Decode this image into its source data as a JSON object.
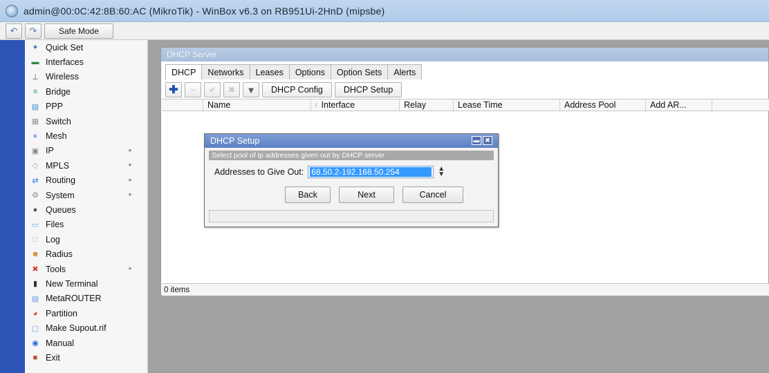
{
  "window": {
    "title": "admin@00:0C:42:8B:60:AC (MikroTik) - WinBox v6.3 on RB951Ui-2HnD (mipsbe)"
  },
  "toolbar": {
    "undo_icon": "undo-icon",
    "redo_icon": "redo-icon",
    "safe_mode": "Safe Mode"
  },
  "menu": [
    {
      "label": "Quick Set",
      "icon": "quick-set-icon",
      "arrow": false,
      "color": "#3a6fb8"
    },
    {
      "label": "Interfaces",
      "icon": "interfaces-icon",
      "arrow": false,
      "color": "#2b8a3e"
    },
    {
      "label": "Wireless",
      "icon": "wireless-icon",
      "arrow": false,
      "color": "#555555"
    },
    {
      "label": "Bridge",
      "icon": "bridge-icon",
      "arrow": false,
      "color": "#2c8f8f"
    },
    {
      "label": "PPP",
      "icon": "ppp-icon",
      "arrow": false,
      "color": "#3a8fd8"
    },
    {
      "label": "Switch",
      "icon": "switch-icon",
      "arrow": false,
      "color": "#9a9a9a"
    },
    {
      "label": "Mesh",
      "icon": "mesh-icon",
      "arrow": false,
      "color": "#5a8fd8"
    },
    {
      "label": "IP",
      "icon": "ip-icon",
      "arrow": true,
      "color": "#8a8a8a"
    },
    {
      "label": "MPLS",
      "icon": "mpls-icon",
      "arrow": true,
      "color": "#9aa4c8"
    },
    {
      "label": "Routing",
      "icon": "routing-icon",
      "arrow": true,
      "color": "#3a7ad8"
    },
    {
      "label": "System",
      "icon": "system-icon",
      "arrow": true,
      "color": "#8a8a8a"
    },
    {
      "label": "Queues",
      "icon": "queues-icon",
      "arrow": false,
      "color": "#555555"
    },
    {
      "label": "Files",
      "icon": "files-icon",
      "arrow": false,
      "color": "#7aa6d8"
    },
    {
      "label": "Log",
      "icon": "log-icon",
      "arrow": false,
      "color": "#a8a8a8"
    },
    {
      "label": "Radius",
      "icon": "radius-icon",
      "arrow": false,
      "color": "#d88a2a"
    },
    {
      "label": "Tools",
      "icon": "tools-icon",
      "arrow": true,
      "color": "#d83a3a"
    },
    {
      "label": "New Terminal",
      "icon": "terminal-icon",
      "arrow": false,
      "color": "#333333"
    },
    {
      "label": "MetaROUTER",
      "icon": "metarouter-icon",
      "arrow": false,
      "color": "#6a9ad8"
    },
    {
      "label": "Partition",
      "icon": "partition-icon",
      "arrow": false,
      "color": "#d8402a"
    },
    {
      "label": "Make Supout.rif",
      "icon": "supout-icon",
      "arrow": false,
      "color": "#6aa0d8"
    },
    {
      "label": "Manual",
      "icon": "manual-icon",
      "arrow": false,
      "color": "#2a6ad8"
    },
    {
      "label": "Exit",
      "icon": "exit-icon",
      "arrow": false,
      "color": "#c84a2a"
    }
  ],
  "dhcp_window": {
    "title": "DHCP Server",
    "tabs": [
      "DHCP",
      "Networks",
      "Leases",
      "Options",
      "Option Sets",
      "Alerts"
    ],
    "buttons": {
      "config": "DHCP Config",
      "setup": "DHCP Setup"
    },
    "columns": [
      "Name",
      "Interface",
      "Relay",
      "Lease Time",
      "Address Pool",
      "Add AR..."
    ],
    "status": "0 items"
  },
  "setup_dialog": {
    "title": "DHCP Setup",
    "subtitle": "Select pool of ip addresses given out by DHCP server",
    "field_label": "Addresses to Give Out:",
    "field_value": "68.50.2-192.168.50.254",
    "back": "Back",
    "next": "Next",
    "cancel": "Cancel"
  }
}
